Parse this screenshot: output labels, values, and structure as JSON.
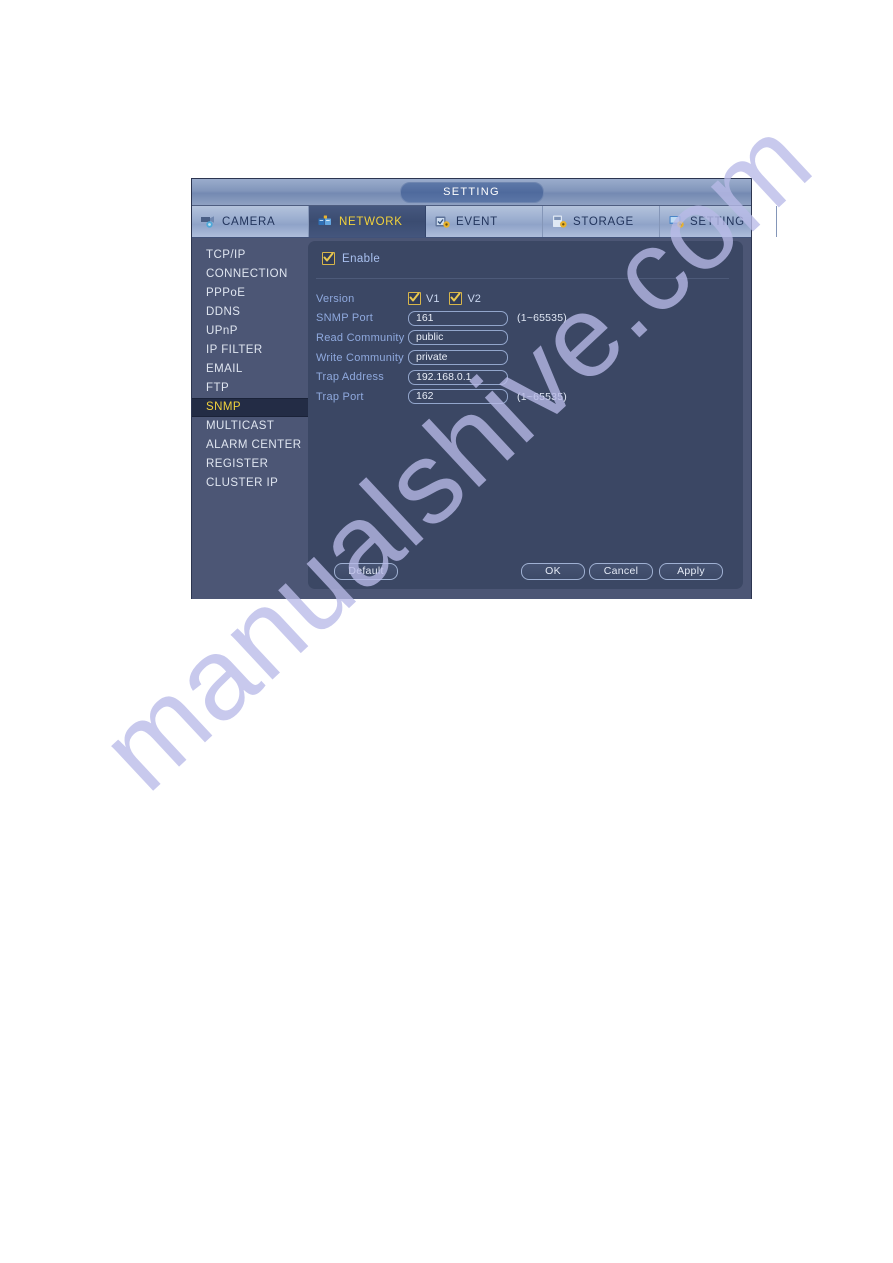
{
  "watermark": {
    "text": "manualshive.com"
  },
  "window": {
    "title": "SETTING"
  },
  "tabs": [
    {
      "label": "CAMERA",
      "icon": "camera-icon",
      "active": false
    },
    {
      "label": "NETWORK",
      "icon": "network-icon",
      "active": true
    },
    {
      "label": "EVENT",
      "icon": "event-icon",
      "active": false
    },
    {
      "label": "STORAGE",
      "icon": "storage-icon",
      "active": false
    },
    {
      "label": "SETTING",
      "icon": "setting-icon",
      "active": false
    }
  ],
  "sidebar": {
    "items": [
      {
        "label": "TCP/IP",
        "active": false
      },
      {
        "label": "CONNECTION",
        "active": false
      },
      {
        "label": "PPPoE",
        "active": false
      },
      {
        "label": "DDNS",
        "active": false
      },
      {
        "label": "UPnP",
        "active": false
      },
      {
        "label": "IP FILTER",
        "active": false
      },
      {
        "label": "EMAIL",
        "active": false
      },
      {
        "label": "FTP",
        "active": false
      },
      {
        "label": "SNMP",
        "active": true
      },
      {
        "label": "MULTICAST",
        "active": false
      },
      {
        "label": "ALARM CENTER",
        "active": false
      },
      {
        "label": "REGISTER",
        "active": false
      },
      {
        "label": "CLUSTER IP",
        "active": false
      }
    ]
  },
  "content": {
    "enable": {
      "label": "Enable",
      "checked": true,
      "icon": "checkbox-checked-icon"
    },
    "version": {
      "label": "Version",
      "options": [
        {
          "label": "V1",
          "checked": true
        },
        {
          "label": "V2",
          "checked": true
        }
      ]
    },
    "fields": [
      {
        "label": "SNMP Port",
        "value": "161",
        "hint": "(1~65535)"
      },
      {
        "label": "Read Community",
        "value": "public",
        "hint": ""
      },
      {
        "label": "Write Community",
        "value": "private",
        "hint": ""
      },
      {
        "label": "Trap Address",
        "value": "192.168.0.1",
        "hint": ""
      },
      {
        "label": "Trap Port",
        "value": "162",
        "hint": "(1~65535)"
      }
    ]
  },
  "footer": {
    "default_label": "Default",
    "ok_label": "OK",
    "cancel_label": "Cancel",
    "apply_label": "Apply"
  },
  "colors": {
    "accent_yellow": "#f2d23c",
    "panel_dark": "#3b4764",
    "sidebar": "#4c5675",
    "label_blue": "#8fa9de",
    "checkbox_border": "#d8b64a"
  }
}
